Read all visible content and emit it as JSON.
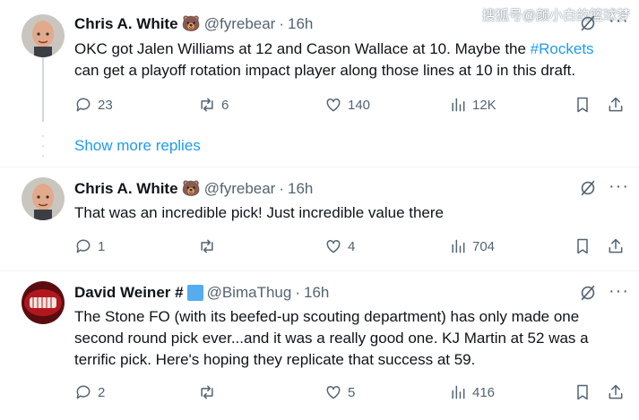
{
  "watermark": "搜狐号@颜小白的篮球梦",
  "show_more": "Show more replies",
  "tweets": [
    {
      "name": "Chris A. White",
      "emoji": "🐻",
      "handle": "@fyrebear",
      "sep": "·",
      "time": "16h",
      "text_before": "OKC got Jalen Williams at 12 and Cason Wallace at 10. Maybe the ",
      "hashtag": "#Rockets",
      "text_after": "can get a playoff rotation impact player along those lines at 10 in this draft.",
      "replies": "23",
      "retweets": "6",
      "likes": "140",
      "views": "12K"
    },
    {
      "name": "Chris A. White",
      "emoji": "🐻",
      "handle": "@fyrebear",
      "sep": "·",
      "time": "16h",
      "text": "That was an incredible pick! Just incredible value there",
      "replies": "1",
      "retweets": "",
      "likes": "4",
      "views": "704"
    },
    {
      "name": "David Weiner #",
      "emoji": "🟦",
      "handle": "@BimaThug",
      "sep": "·",
      "time": "16h",
      "text_line1": "The Stone FO (with its beefed-up scouting department) has only made one",
      "text_line2": "second round pick ever...and it was a really good one. KJ Martin at 52 was a",
      "text_line3": "terrific pick. Here's hoping they replicate that success at 59.",
      "replies": "2",
      "retweets": "",
      "likes": "5",
      "views": "416"
    }
  ],
  "colors": {
    "link": "#1d9bf0",
    "text": "#0f1419",
    "muted": "#536471"
  }
}
